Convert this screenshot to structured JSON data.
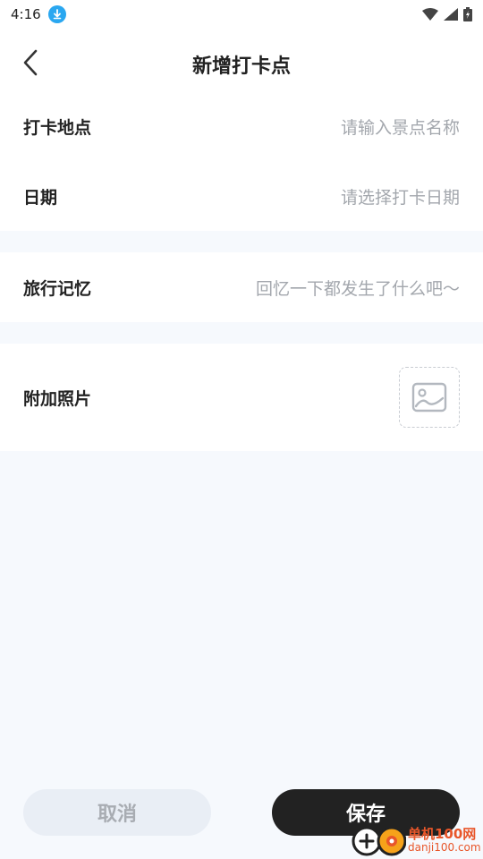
{
  "status_bar": {
    "time": "4:16",
    "download_icon": "download-badge-icon",
    "icons": [
      "wifi-icon",
      "signal-icon",
      "battery-charging-icon"
    ]
  },
  "header": {
    "title": "新增打卡点",
    "back_icon": "chevron-left-icon"
  },
  "form": {
    "location": {
      "label": "打卡地点",
      "placeholder": "请输入景点名称"
    },
    "date": {
      "label": "日期",
      "placeholder": "请选择打卡日期"
    },
    "memory": {
      "label": "旅行记忆",
      "placeholder": "回忆一下都发生了什么吧～"
    },
    "photo": {
      "label": "附加照片",
      "icon": "image-placeholder-icon"
    }
  },
  "actions": {
    "cancel_label": "取消",
    "save_label": "保存"
  },
  "watermark": {
    "line1": "单机100网",
    "line2": "danji100.com"
  },
  "colors": {
    "background": "#f6f9fd",
    "card": "#ffffff",
    "placeholder_text": "#a3a7ad",
    "save_button": "#222222",
    "cancel_button": "#e9eef5",
    "download_badge": "#2aa7f0"
  }
}
